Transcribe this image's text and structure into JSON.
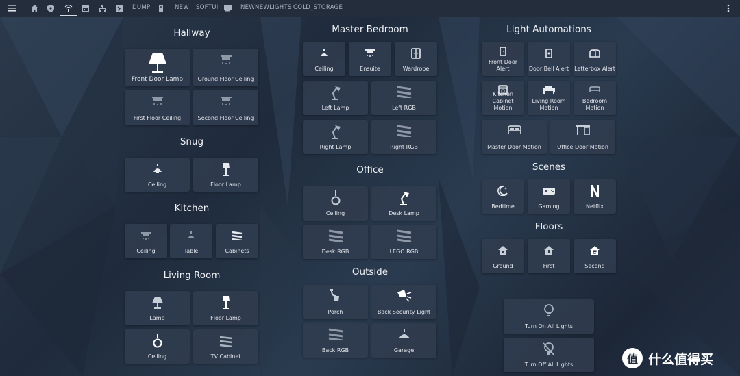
{
  "topbar": {
    "tabs": [
      "DUMP",
      "NEW",
      "SOFTUI",
      "NEWNEWLIGHTS",
      "COLD_STORAGE"
    ],
    "icons": [
      "menu-icon",
      "home-icon",
      "shield-icon",
      "router-icon",
      "calendar-icon",
      "network-icon",
      "terminal-icon",
      "remote-icon",
      "tv-icon",
      "more-vert-icon"
    ]
  },
  "hallway": {
    "title": "Hallway",
    "tiles": [
      "Front Door Lamp",
      "Ground Floor Ceiling",
      "First Floor Ceiling",
      "Second Floor Ceiling"
    ]
  },
  "snug": {
    "title": "Snug",
    "tiles": [
      "Ceiling",
      "Floor Lamp"
    ]
  },
  "kitchen": {
    "title": "Kitchen",
    "tiles": [
      "Ceiling",
      "Table",
      "Cabinets"
    ]
  },
  "living_room": {
    "title": "Living Room",
    "tiles": [
      "Lamp",
      "Floor Lamp",
      "Ceiling",
      "TV Cabinet"
    ]
  },
  "master_bedroom": {
    "title": "Master Bedroom",
    "tiles": [
      "Ceiling",
      "Ensuite",
      "Wardrobe",
      "Left Lamp",
      "Left RGB",
      "Right Lamp",
      "Right RGB"
    ]
  },
  "office": {
    "title": "Office",
    "tiles": [
      "Ceiling",
      "Desk Lamp",
      "Desk RGB",
      "LEGO RGB"
    ]
  },
  "outside": {
    "title": "Outside",
    "tiles": [
      "Porch",
      "Back Security Light",
      "Back RGB",
      "Garage"
    ]
  },
  "light_automations": {
    "title": "Light Automations",
    "tiles": [
      "Front Door Alert",
      "Door Bell Alert",
      "Letterbox Alert",
      "Kitchen Cabinet Motion",
      "Living Room Motion",
      "Bedroom Motion",
      "Master Door Motion",
      "Office Door Motion"
    ]
  },
  "scenes": {
    "title": "Scenes",
    "tiles": [
      "Bedtime",
      "Gaming",
      "Netflix"
    ]
  },
  "floors": {
    "title": "Floors",
    "tiles": [
      "Ground",
      "First",
      "Second"
    ]
  },
  "all_lights": {
    "on": "Turn On All Lights",
    "off": "Turn Off All Lights"
  },
  "watermark": {
    "symbol": "值",
    "text": "什么值得买"
  },
  "colors": {
    "tile_bg": "#303c4e",
    "topbar_bg": "#232d3b",
    "text": "#e6e9ee"
  }
}
